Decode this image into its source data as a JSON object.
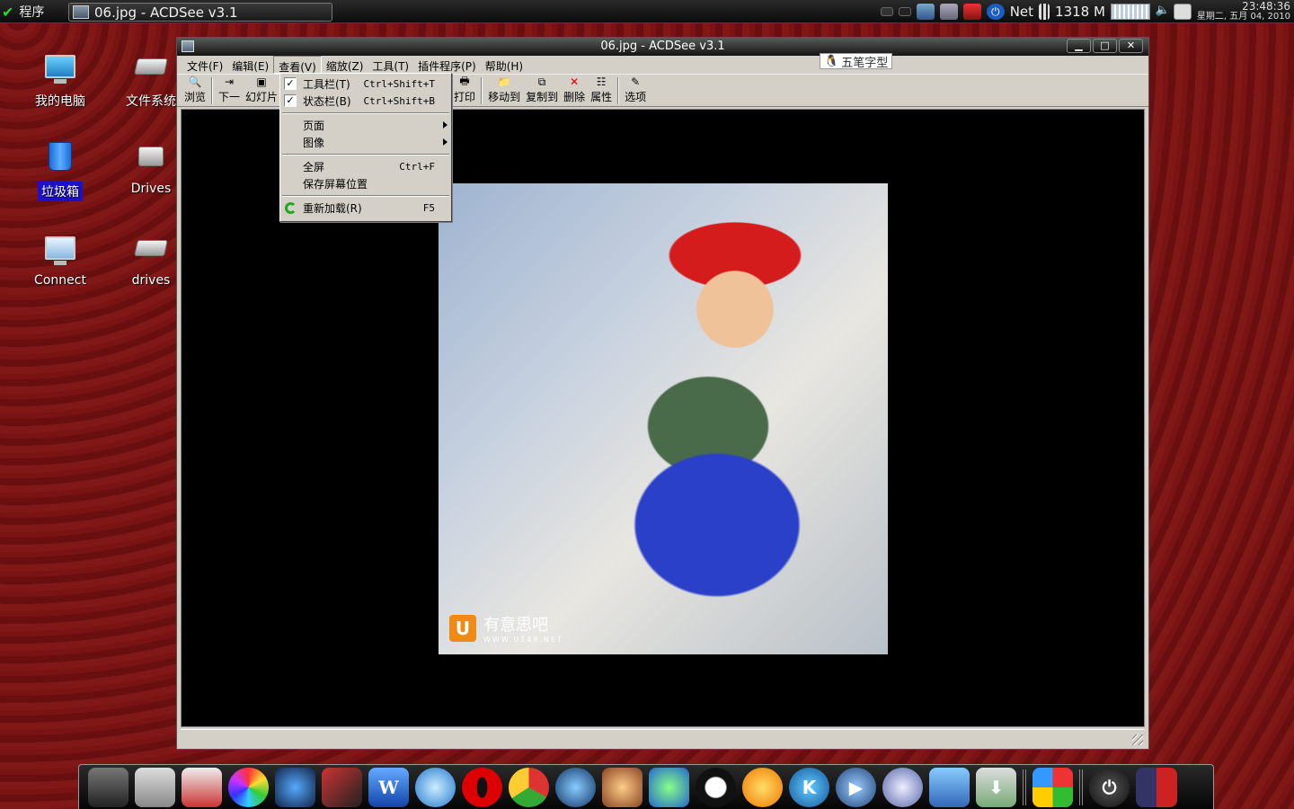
{
  "panel": {
    "menu_label": "程序",
    "task_title": "06.jpg - ACDSee v3.1",
    "net_label": "Net",
    "mem_label": "1318 M",
    "time": "23:48:36",
    "date": "星期二, 五月 04, 2010"
  },
  "desktop": {
    "icons": [
      {
        "label": "我的电脑"
      },
      {
        "label": "文件系统"
      },
      {
        "label": "垃圾箱"
      },
      {
        "label": "Drives"
      },
      {
        "label": "Connect"
      },
      {
        "label": "drives"
      }
    ]
  },
  "window": {
    "title": "06.jpg - ACDSee v3.1",
    "min": "▁",
    "max": "□",
    "close": "✕",
    "ime": "五笔字型",
    "menu": [
      "文件(F)",
      "编辑(E)",
      "查看(V)",
      "缩放(Z)",
      "工具(T)",
      "插件程序(P)",
      "帮助(H)"
    ],
    "toolbar": {
      "browse": "浏览",
      "next": "下一",
      "slideshow": "幻灯片",
      "print": "打印",
      "move": "移动到",
      "copy": "复制到",
      "delete": "删除",
      "properties": "属性",
      "options": "选项"
    }
  },
  "view_menu": {
    "toolbar": {
      "label": "工具栏(T)",
      "shortcut": "Ctrl+Shift+T",
      "checked": true
    },
    "statusbar": {
      "label": "状态栏(B)",
      "shortcut": "Ctrl+Shift+B",
      "checked": true
    },
    "page": "页面",
    "image": "图像",
    "fullscreen": {
      "label": "全屏",
      "shortcut": "Ctrl+F"
    },
    "save_pos": "保存屏幕位置",
    "reload": {
      "label": "重新加载(R)",
      "shortcut": "F5"
    },
    "check_mark": "✓"
  },
  "photo": {
    "wm_logo": "U",
    "wm_text": "有意思吧",
    "wm_sub": "WWW.U148.NET"
  },
  "dock": {
    "items": [
      "monitor-icon",
      "camera-icon",
      "mail-icon",
      "color-icon",
      "earth-icon",
      "pen-icon",
      "word-icon",
      "browser-icon",
      "opera-icon",
      "chrome-icon",
      "thunderbird-icon",
      "fox-icon",
      "msn-icon",
      "qq-icon",
      "music-icon",
      "k-icon",
      "play-icon",
      "chat-icon",
      "home-icon",
      "download-icon",
      "windows-icon",
      "power-icon",
      "workspace-icon"
    ]
  }
}
